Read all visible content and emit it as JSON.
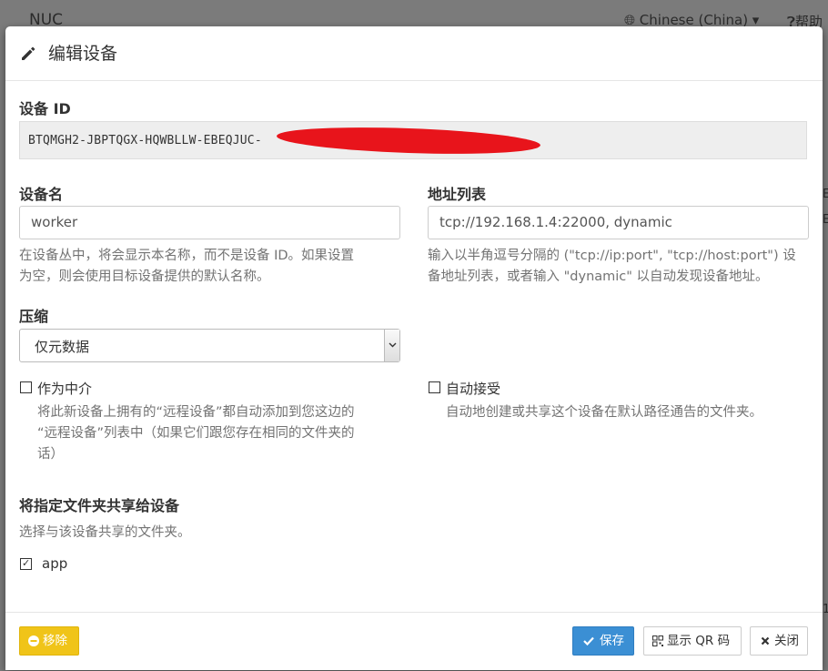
{
  "background": {
    "brand": "NUC",
    "language": "Chinese (China) ▾",
    "help": "帮助",
    "side_glyphs": [
      "E",
      "E",
      "1"
    ]
  },
  "modal": {
    "title": "编辑设备",
    "device_id_label": "设备 ID",
    "device_id_value": "BTQMGH2-JBPTQGX-HQWBLLW-EBEQJUC-",
    "device_name_label": "设备名",
    "device_name_value": "worker",
    "device_name_help": [
      "在设备丛中，将会显示本名称，而不是设备 ID。如果设置",
      "为空，则会使用目标设备提供的默认名称。"
    ],
    "address_label": "地址列表",
    "address_value": "tcp://192.168.1.4:22000, dynamic",
    "address_help": [
      "输入以半角逗号分隔的 (\"tcp://ip:port\", \"tcp://host:port\") 设",
      "备地址列表，或者输入 \"dynamic\" 以自动发现设备地址。"
    ],
    "compression_label": "压缩",
    "compression_value": "仅元数据",
    "introducer_label": "作为中介",
    "introducer_help": [
      "将此新设备上拥有的“远程设备”都自动添加到您这边的",
      "“远程设备”列表中（如果它们跟您存在相同的文件夹的",
      "话）"
    ],
    "auto_accept_label": "自动接受",
    "auto_accept_help": "自动地创建或共享这个设备在默认路径通告的文件夹。",
    "share_heading": "将指定文件夹共享给设备",
    "share_help": "选择与该设备共享的文件夹。",
    "folder_name": "app",
    "folder_checked": true,
    "introducer_checked": false,
    "auto_accept_checked": false
  },
  "footer": {
    "remove_label": "移除",
    "save_label": "保存",
    "qr_label": "显示 QR 码",
    "close_label": "关闭"
  },
  "colors": {
    "primary": "#3b8fd4",
    "warning": "#f0c419",
    "redaction": "#e8141b"
  }
}
